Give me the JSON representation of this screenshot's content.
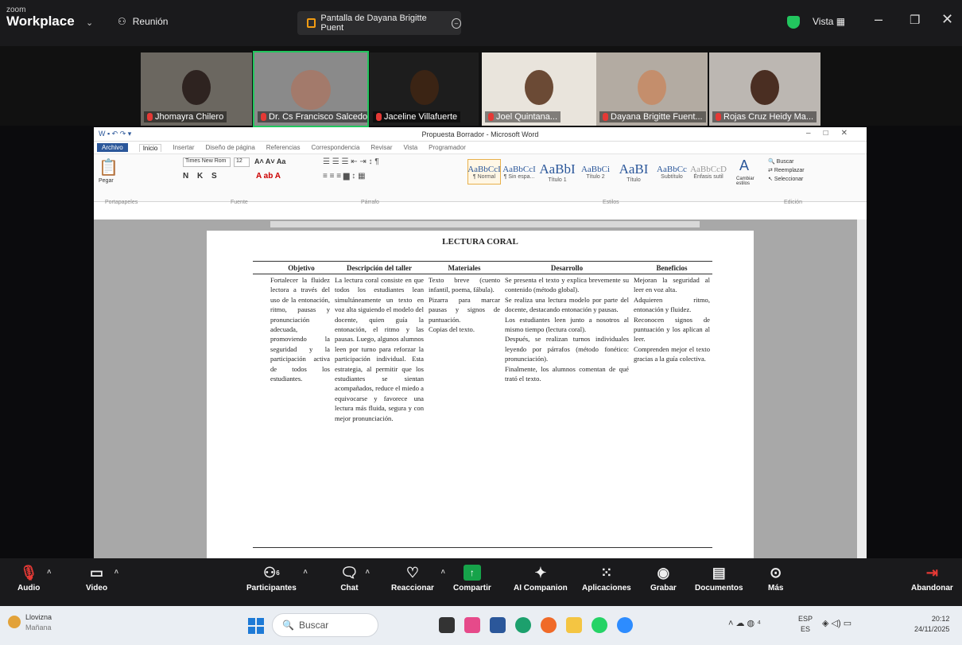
{
  "app": {
    "brand_small": "zoom",
    "brand": "Workplace"
  },
  "topbar": {
    "meeting_label": "Reunión",
    "share_tab": "Pantalla de Dayana Brigitte Puent",
    "view_label": "Vista"
  },
  "participants": [
    {
      "name": "Jhomayra Chilero"
    },
    {
      "name": "Dr. Cs Francisco Salcedo..."
    },
    {
      "name": "Jaceline Villafuerte"
    },
    {
      "name": "Joel Quintana..."
    },
    {
      "name": "Dayana Brigitte Fuent..."
    },
    {
      "name": "Rojas Cruz Heidy  Ma..."
    }
  ],
  "word": {
    "title": "Propuesta Borrador  -  Microsoft Word",
    "tabs": [
      "Archivo",
      "Inicio",
      "Insertar",
      "Diseño de página",
      "Referencias",
      "Correspondencia",
      "Revisar",
      "Vista",
      "Programador"
    ],
    "font_name": "Times New Rom",
    "font_size": "12",
    "styles": [
      {
        "sample": "AaBbCcI",
        "name": "¶ Normal"
      },
      {
        "sample": "AaBbCcI",
        "name": "¶ Sin espa..."
      },
      {
        "sample": "AaBbI",
        "name": "Título 1"
      },
      {
        "sample": "AaBbCi",
        "name": "Título 2"
      },
      {
        "sample": "AaBI",
        "name": "Título"
      },
      {
        "sample": "AaBbCc",
        "name": "Subtítulo"
      },
      {
        "sample": "AaBbCcD",
        "name": "Énfasis sutil"
      }
    ],
    "group_labels": [
      "Portapapeles",
      "Fuente",
      "Párrafo",
      "Estilos",
      "Edición"
    ],
    "edit_buttons": [
      "Buscar",
      "Reemplazar",
      "Seleccionar"
    ],
    "paste_label": "Pegar",
    "change_styles": "Cambiar estilos"
  },
  "document": {
    "heading": "LECTURA CORAL",
    "columns": [
      "Objetivo",
      "Descripción del taller",
      "Materiales",
      "Desarrollo",
      "Beneficios"
    ],
    "cells": [
      "Fortalecer la fluidez lectora a través del uso de la entonación, ritmo, pausas y pronunciación adecuada, promoviendo la seguridad y la participación activa de todos los estudiantes.",
      "La lectura coral consiste en que todos los estudiantes lean simultáneamente un texto en voz alta siguiendo el modelo del docente, quien guía la entonación, el ritmo y las pausas. Luego, algunos alumnos leen por turno para reforzar la participación individual. Esta estrategia, al permitir que los estudiantes se sientan acompañados, reduce el miedo a equivocarse y favorece una lectura más fluida, segura y con mejor pronunciación.",
      "Texto breve (cuento infantil, poema, fábula).\nPizarra para marcar pausas y signos de puntuación.\nCopias del texto.",
      "Se presenta el texto y explica brevemente su contenido (método global).\nSe realiza una lectura modelo por parte del docente, destacando entonación y pausas.\nLos estudiantes leen junto a nosotros al mismo tiempo (lectura coral).\nDespués, se realizan turnos individuales leyendo por párrafos (método fonético: pronunciación).\nFinalmente, los alumnos comentan de qué trató el texto.",
      "Mejoran la seguridad al leer en voz alta.\nAdquieren ritmo, entonación y fluidez.\nReconocen signos de puntuación y los aplican al leer.\nComprenden mejor el texto gracias a la guía colectiva."
    ]
  },
  "toolbar": {
    "audio": "Audio",
    "video": "Video",
    "participants": "Participantes",
    "participants_count": "6",
    "chat": "Chat",
    "react": "Reaccionar",
    "share": "Compartir",
    "ai": "AI Companion",
    "apps": "Aplicaciones",
    "record": "Grabar",
    "docs": "Documentos",
    "more": "Más",
    "leave": "Abandonar"
  },
  "taskbar": {
    "weather_title": "Llovizna",
    "weather_sub": "Mañana",
    "search": "Buscar",
    "lang1": "ESP",
    "lang2": "ES",
    "time": "20:12",
    "date": "24/11/2025"
  },
  "colors": {
    "zoom_green": "#22c55e",
    "word_blue": "#2b579a",
    "leave_red": "#e53935"
  }
}
